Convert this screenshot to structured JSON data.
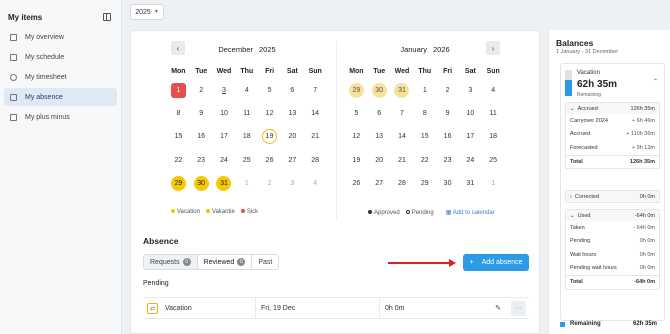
{
  "sidebar": {
    "title": "My items",
    "items": [
      {
        "label": "My overview"
      },
      {
        "label": "My schedule"
      },
      {
        "label": "My timesheet"
      },
      {
        "label": "My absence"
      },
      {
        "label": "My plus minus"
      }
    ]
  },
  "year_select": {
    "value": "2025"
  },
  "calendar": {
    "left": {
      "month": "December",
      "year": "2025"
    },
    "right": {
      "month": "January",
      "year": "2026"
    },
    "weekdays": [
      "Mon",
      "Tue",
      "Wed",
      "Thu",
      "Fri",
      "Sat",
      "Sun"
    ],
    "legend_left": [
      "Vacation",
      "Vakantie",
      "Sick"
    ],
    "legend_right": [
      "Approved",
      "Pending"
    ],
    "add_to_calendar": "Add to calendar",
    "colors": {
      "vacation": "#f5c800",
      "vakantie": "#f6e29a",
      "sick": "#e84d4d"
    }
  },
  "absence": {
    "title": "Absence",
    "tabs": [
      {
        "label": "Requests",
        "count": "0"
      },
      {
        "label": "Reviewed",
        "count": "0"
      },
      {
        "label": "Past"
      }
    ],
    "add_button": "Add absence",
    "pending_title": "Pending",
    "pending_row": {
      "type": "Vacation",
      "date": "Fri, 19 Dec",
      "hours": "0h 0m"
    }
  },
  "balances": {
    "title": "Balances",
    "range": "1 January - 31 December",
    "vacation": {
      "name": "Vacation",
      "hours": "62h 35m",
      "remaining_label": "Remaining",
      "remaining_fraction": 0.6
    },
    "accrued": {
      "label": "Accrued",
      "value": "126h 35m",
      "lines": [
        {
          "label": "Carryover 2024",
          "value": "+ 6h 46m"
        },
        {
          "label": "Accrued",
          "value": "+ 110h 36m"
        },
        {
          "label": "Forecasted",
          "value": "+ 9h 13m"
        }
      ],
      "total_label": "Total",
      "total_value": "126h 35m"
    },
    "corrected": {
      "label": "Corrected",
      "value": "0h 0m"
    },
    "used": {
      "label": "Used",
      "value": "-64h 0m",
      "lines": [
        {
          "label": "Taken",
          "value": "- 64h 0m"
        },
        {
          "label": "Pending",
          "value": "0h 0m"
        },
        {
          "label": "Wait hours",
          "value": "0h 0m"
        },
        {
          "label": "Pending wait hours",
          "value": "0h 0m"
        }
      ],
      "total_label": "Total",
      "total_value": "-64h 0m"
    },
    "remaining_row": {
      "label": "Remaining",
      "value": "62h 35m"
    }
  }
}
